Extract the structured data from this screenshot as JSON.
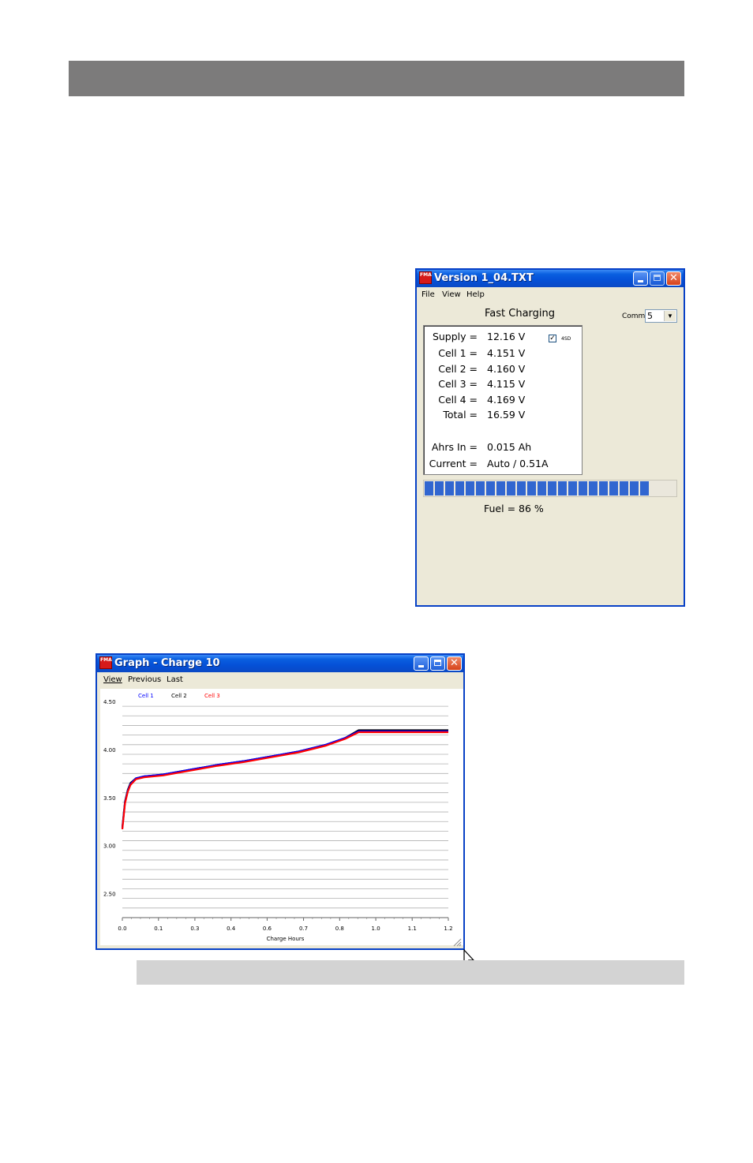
{
  "version_window": {
    "title": "Version 1_04.TXT",
    "app_icon_text": "FMA",
    "menu": [
      "File",
      "View",
      "Help"
    ],
    "status_title": "Fast Charging",
    "comm_label": "Comm",
    "comm_value": "5",
    "checkbox_label": "4SD",
    "checkbox_checked": true,
    "readings": [
      {
        "label": "Supply =",
        "value": "12.16 V"
      },
      {
        "label": "Cell 1 =",
        "value": "4.151 V"
      },
      {
        "label": "Cell 2 =",
        "value": "4.160 V"
      },
      {
        "label": "Cell 3 =",
        "value": "4.115 V"
      },
      {
        "label": "Cell 4 =",
        "value": "4.169 V"
      },
      {
        "label": "Total =",
        "value": "16.59 V"
      },
      {
        "label": "Ahrs In =",
        "value": "0.015 Ah"
      },
      {
        "label": "Current =",
        "value": "Auto / 0.51A"
      }
    ],
    "fuel_text": "Fuel =  86  %",
    "fuel_fraction": 0.86
  },
  "graph_window": {
    "title": "Graph - Charge 10",
    "app_icon_text": "FMA",
    "menu": [
      "View",
      "Previous",
      "Last"
    ]
  },
  "colors": {
    "cell1": "#0000ff",
    "cell2": "#000000",
    "cell3": "#ff0000",
    "top_bar": "#7c7b7b",
    "caption_bar": "#d3d3d3",
    "fuel": "#3166d0"
  },
  "chart_data": {
    "type": "line",
    "title": "",
    "xlabel": "Charge Hours",
    "ylabel": "",
    "xlim": [
      0.0,
      1.2
    ],
    "ylim": [
      2.25,
      4.5
    ],
    "x_ticks": [
      "0.0",
      "0.1",
      "0.3",
      "0.4",
      "0.6",
      "0.7",
      "0.8",
      "1.0",
      "1.1",
      "1.2"
    ],
    "x_tick_values": [
      0.0,
      0.133,
      0.267,
      0.4,
      0.533,
      0.667,
      0.8,
      0.933,
      1.067,
      1.2
    ],
    "y_ticks": [
      "4.50",
      "4.00",
      "3.50",
      "3.00",
      "2.50"
    ],
    "y_tick_values": [
      4.5,
      4.0,
      3.5,
      3.0,
      2.5
    ],
    "legend_position": "top-left",
    "grid": true,
    "x": [
      0.0,
      0.01,
      0.02,
      0.03,
      0.05,
      0.08,
      0.15,
      0.25,
      0.35,
      0.45,
      0.55,
      0.65,
      0.75,
      0.82,
      0.87,
      0.9,
      1.0,
      1.1,
      1.2
    ],
    "series": [
      {
        "name": "Cell 1",
        "color": "#0000ff",
        "values": [
          3.18,
          3.45,
          3.57,
          3.64,
          3.7,
          3.72,
          3.74,
          3.79,
          3.84,
          3.88,
          3.93,
          3.98,
          4.05,
          4.12,
          4.19,
          4.19,
          4.19,
          4.19,
          4.19
        ]
      },
      {
        "name": "Cell 2",
        "color": "#000000",
        "values": [
          3.19,
          3.46,
          3.58,
          3.65,
          3.7,
          3.72,
          3.74,
          3.79,
          3.84,
          3.88,
          3.93,
          3.98,
          4.05,
          4.12,
          4.2,
          4.2,
          4.2,
          4.2,
          4.2
        ]
      },
      {
        "name": "Cell 3",
        "color": "#ff0000",
        "values": [
          3.17,
          3.44,
          3.56,
          3.63,
          3.69,
          3.71,
          3.73,
          3.78,
          3.83,
          3.87,
          3.92,
          3.97,
          4.04,
          4.11,
          4.18,
          4.18,
          4.18,
          4.18,
          4.18
        ]
      }
    ]
  }
}
